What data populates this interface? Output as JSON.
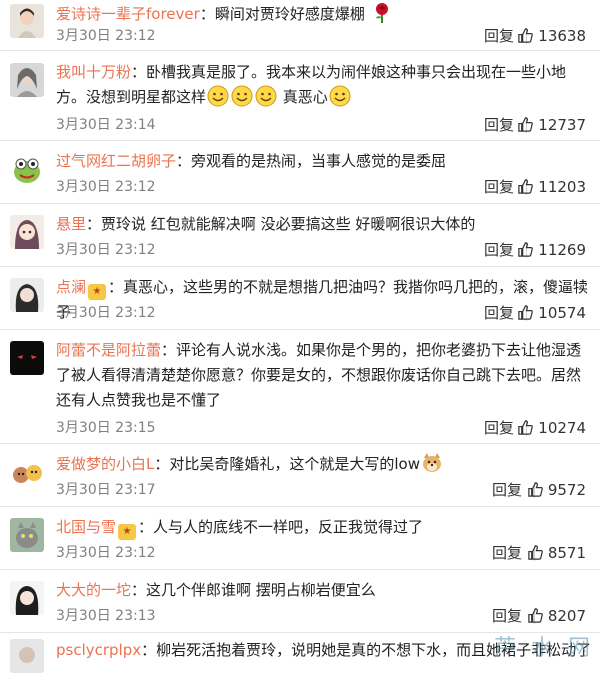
{
  "comments": [
    {
      "user": "爱诗诗一辈子forever",
      "text": "瞬间对贾玲好感度爆棚",
      "emoji": "rose",
      "timestamp": "3月30日 23:12",
      "reply_label": "回复",
      "likes": "13638",
      "avatar": "person-1"
    },
    {
      "user": "我叫十万粉",
      "text": "卧槽我真是服了。我本来以为闹伴娘这种事只会出现在一些小地方。没想到明星都这样",
      "after_emoji_text": "真恶心",
      "emoji": "smiley",
      "timestamp": "3月30日 23:14",
      "reply_label": "回复",
      "likes": "12737",
      "avatar": "person-2"
    },
    {
      "user": "过气网红二胡卵子",
      "text": "旁观看的是热闹，当事人感觉的是委屈",
      "timestamp": "3月30日 23:12",
      "reply_label": "回复",
      "likes": "11203",
      "avatar": "cartoon-frog"
    },
    {
      "user": "悬里",
      "text": "贾玲说 红包就能解决啊 没必要搞这些 好暖啊很识大体的",
      "timestamp": "3月30日 23:12",
      "reply_label": "回复",
      "likes": "11269",
      "avatar": "anime-girl"
    },
    {
      "user": "点澜",
      "text": "真恶心，这些男的不就是想揩几把油吗？我揩你吗几把的，滚，傻逼犊子",
      "timestamp": "3月30日 23:12",
      "reply_label": "回复",
      "likes": "10574",
      "avatar": "person-3"
    },
    {
      "user": "阿蕾不是阿拉蕾",
      "text": "评论有人说水浅。如果你是个男的，把你老婆扔下去让他湿透了被人看得清清楚楚你愿意？你要是女的，不想跟你废话你自己跳下去吧。居然还有人点赞我也是不懂了",
      "timestamp": "3月30日 23:15",
      "reply_label": "回复",
      "likes": "10274",
      "avatar": "dark-eyes"
    },
    {
      "user": "爱做梦的小白L",
      "text": "对比吴奇隆婚礼，这个就是大写的low",
      "emoji": "dog",
      "timestamp": "3月30日 23:17",
      "reply_label": "回复",
      "likes": "9572",
      "avatar": "cartoon-bear"
    },
    {
      "user": "北国与雪",
      "text": "人与人的底线不一样吧，反正我觉得过了",
      "timestamp": "3月30日 23:12",
      "reply_label": "回复",
      "likes": "8571",
      "avatar": "cat"
    },
    {
      "user": "大大的一坨",
      "text": "这几个伴郎谁啊 摆明占柳岩便宜么",
      "timestamp": "3月30日 23:13",
      "reply_label": "回复",
      "likes": "8207",
      "avatar": "person-4"
    },
    {
      "user": "psclycrplpx",
      "text": "柳岩死活抱着贾玲，说明她是真的不想下水，而且她裙子非松动了，所在",
      "avatar": "person-5"
    }
  ],
  "watermark": "芦 水 网"
}
